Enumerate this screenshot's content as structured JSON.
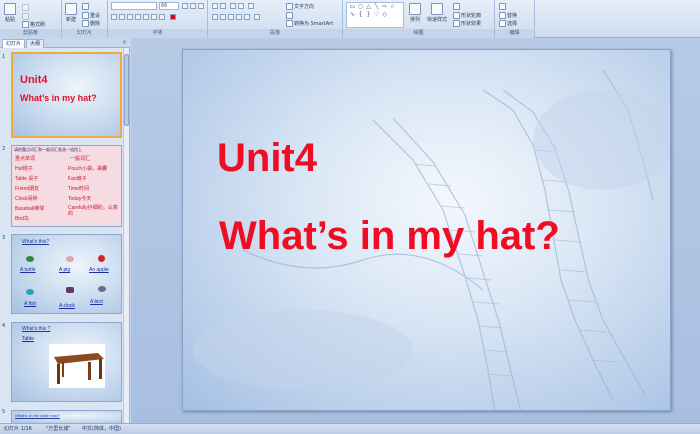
{
  "ribbon": {
    "groups": [
      {
        "caption": "剪贴板"
      },
      {
        "caption": "幻灯片"
      },
      {
        "caption": "字体"
      },
      {
        "caption": "段落"
      },
      {
        "caption": "绘图"
      },
      {
        "caption": "编辑"
      }
    ],
    "paste_label": "粘贴",
    "format_painter_label": "格式刷",
    "new_slide_label": "新建",
    "reset_label": "重设",
    "delete_label": "删除",
    "font_size": "66",
    "text_direction_label": "文字方向",
    "convert_smartart_label": "转换为 SmartArt",
    "arrange_label": "排列",
    "quick_styles_label": "快速样式",
    "shape_outline_label": "形状轮廓",
    "shape_effects_label": "形状效果",
    "replace_label": "替换",
    "select_label": "选择"
  },
  "panel": {
    "tab_slides": "幻灯片",
    "tab_outline": "大纲",
    "close": "×",
    "slides": [
      {
        "num": "1",
        "line1": "Unit4",
        "line2": "What’s in my hat?"
      },
      {
        "num": "2",
        "header": "请把重点词汇和一般词汇各选一组找上",
        "left": [
          "重点单词",
          "Hat帽子",
          "Table 桌子",
          "Friend朋友",
          "Clock闹钟",
          "Baseball棒球",
          "Bird鸟"
        ],
        "right": [
          "一般词汇",
          "Pouch小袋，袋囊",
          "Fan扇子",
          "Time时间",
          "Today今天",
          "Carefully仔细的，认真的"
        ]
      },
      {
        "num": "3",
        "question": "What's this?",
        "items": [
          "A turtle",
          "A pig",
          "An apple",
          "A fish",
          "A clock",
          "A bird"
        ]
      },
      {
        "num": "4",
        "question": "What's this ?",
        "answer": "Table"
      },
      {
        "num": "5",
        "question": "What's on the table now?"
      }
    ]
  },
  "slide": {
    "line1": "Unit4",
    "line2": "What’s in my hat?"
  },
  "status": {
    "slide_counter": "幻灯片 1/16",
    "theme": "\"万里长城\"",
    "language": "中文(简体，中国)"
  }
}
